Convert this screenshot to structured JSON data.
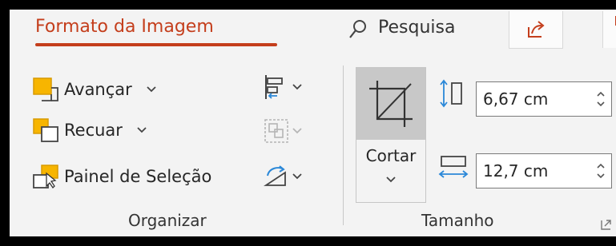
{
  "tabs": {
    "active_label": "Formato da Imagem",
    "search_label": "Pesquisa"
  },
  "organizar": {
    "items": [
      {
        "label": "Avançar"
      },
      {
        "label": "Recuar"
      },
      {
        "label": "Painel de Seleção"
      }
    ],
    "group_label": "Organizar"
  },
  "tamanho": {
    "crop_label": "Cortar",
    "height_value": "6,67 cm",
    "width_value": "12,7 cm",
    "group_label": "Tamanho"
  },
  "colors": {
    "accent": "#c43e1c",
    "icon_orange": "#f7b500",
    "icon_blue": "#2b88d8"
  }
}
